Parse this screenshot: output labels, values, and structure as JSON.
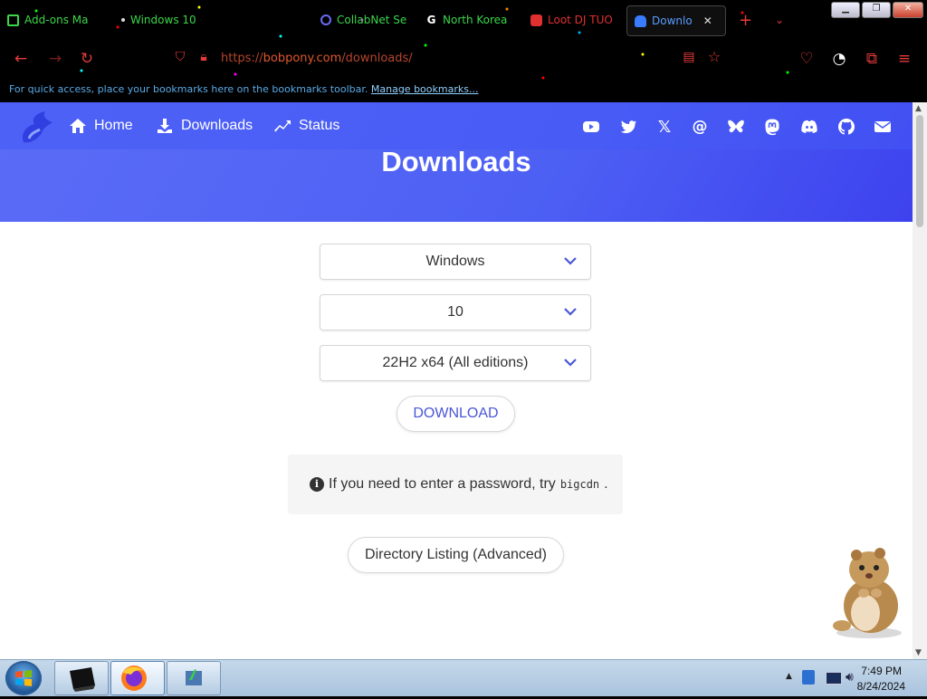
{
  "browser": {
    "tabs": [
      {
        "label": "Add-ons Ma",
        "icon": "puzzle-icon",
        "color": "#3bd64a"
      },
      {
        "label": "Windows 10",
        "icon": "dot-icon",
        "color": "#3bd64a"
      },
      {
        "label": "CollabNet Se",
        "icon": "search-icon",
        "color": "#6a6cf6"
      },
      {
        "label": "North Korea",
        "icon": "google-icon",
        "color": "#3bd64a"
      },
      {
        "label": "Loot DJ TUO",
        "icon": "youtube-icon",
        "color": "#e03030"
      },
      {
        "label": "Downlo",
        "icon": "butterfly-icon",
        "color": "#5a9cff"
      }
    ],
    "url": {
      "prefix": "https://",
      "host": "bobpony.com",
      "path": "/downloads/"
    },
    "bookmarks_hint": "For quick access, place your bookmarks here on the bookmarks toolbar.",
    "bookmarks_link": "Manage bookmarks..."
  },
  "site": {
    "nav": [
      {
        "label": "Home",
        "icon": "home-icon"
      },
      {
        "label": "Downloads",
        "icon": "download-icon"
      },
      {
        "label": "Status",
        "icon": "trend-icon"
      }
    ],
    "social": [
      "youtube-icon",
      "twitter-icon",
      "x-icon",
      "threads-icon",
      "bluesky-icon",
      "mastodon-icon",
      "discord-icon",
      "github-icon",
      "mail-icon"
    ],
    "title": "Downloads"
  },
  "form": {
    "os_select": "Windows",
    "version_select": "10",
    "edition_select": "22H2 x64 (All editions)",
    "download_label": "DOWNLOAD",
    "info_text": "If you need to enter a password, try",
    "info_code": "bigcdn",
    "info_suffix": ".",
    "dirlist_label": "Directory Listing (Advanced)"
  },
  "taskbar": {
    "time": "7:49 PM",
    "date": "8/24/2024"
  },
  "colors": {
    "accent": "#4d5ff4",
    "link": "#4a56d6"
  }
}
